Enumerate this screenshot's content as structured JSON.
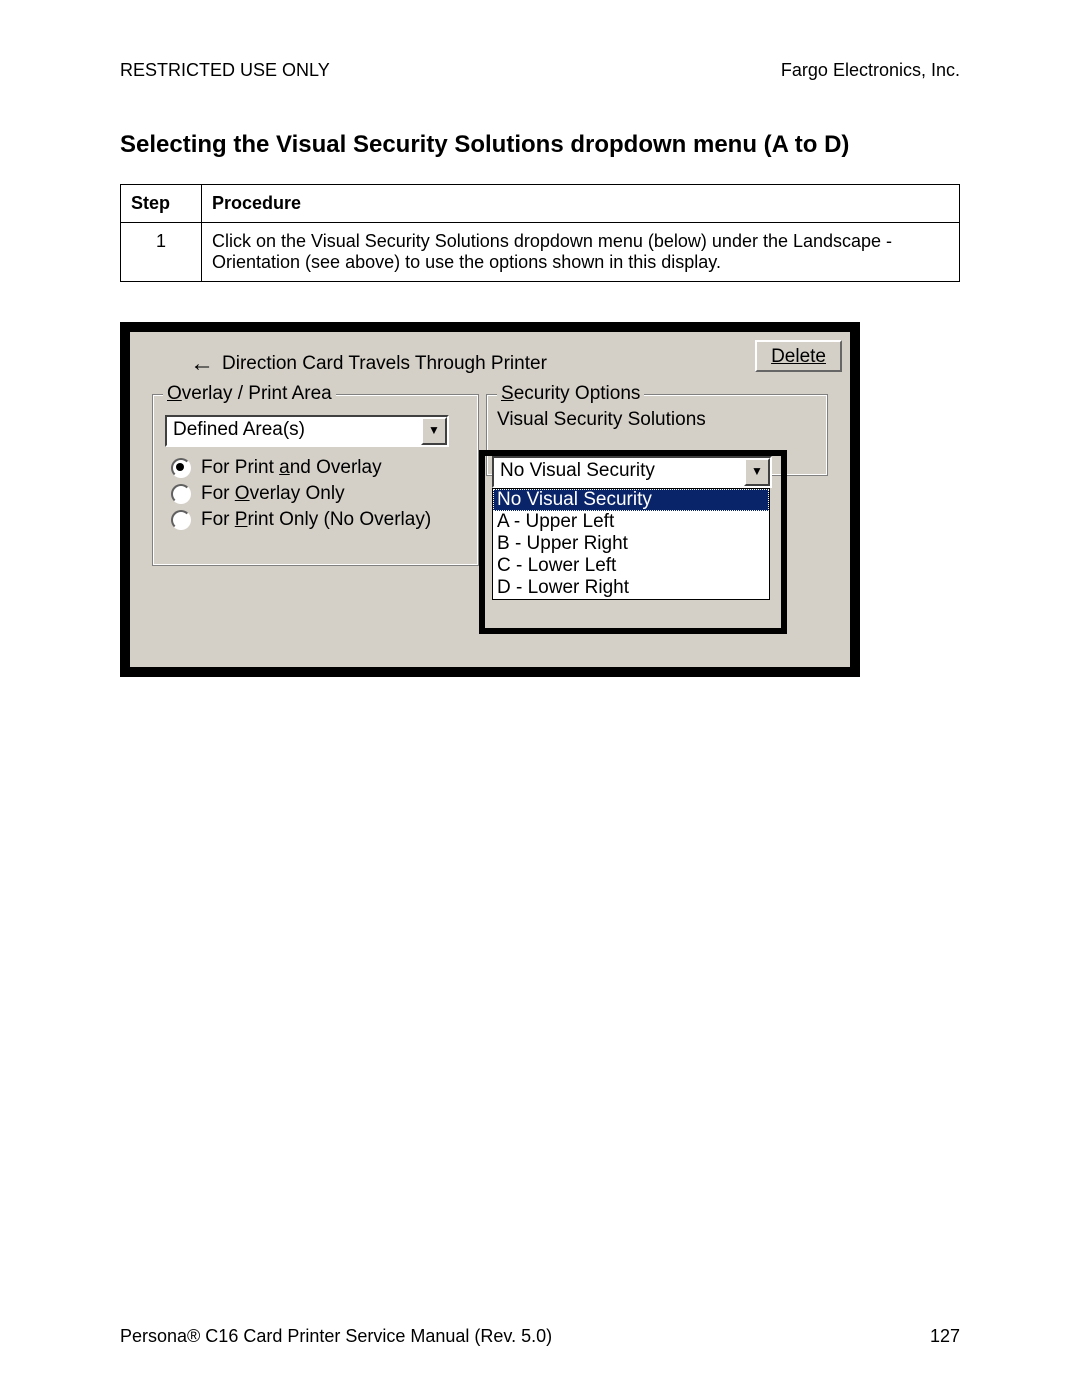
{
  "header": {
    "left": "RESTRICTED USE ONLY",
    "right": "Fargo Electronics, Inc."
  },
  "section_title": "Selecting the Visual Security Solutions dropdown menu (A to D)",
  "table": {
    "col1": "Step",
    "col2": "Procedure",
    "row1_step": "1",
    "row1_proc": "Click on the Visual Security Solutions dropdown menu (below) under the Landscape - Orientation (see above) to use the options shown in this display."
  },
  "ui": {
    "direction_label": "Direction Card Travels Through Printer",
    "delete_btn": "Delete",
    "overlay_group": "verlay / Print Area",
    "overlay_group_ul": "O",
    "overlay_combo": "Defined Area(s)",
    "radio1_pre": "For Print ",
    "radio1_ul": "a",
    "radio1_post": "nd Overlay",
    "radio2_pre": "For ",
    "radio2_ul": "O",
    "radio2_post": "verlay Only",
    "radio3_pre": "For ",
    "radio3_ul": "P",
    "radio3_post": "rint Only (No Overlay)",
    "security_group_ul": "S",
    "security_group": "ecurity Options",
    "security_label": "Visual Security Solutions",
    "security_combo": "No Visual Security",
    "options": {
      "o0": "No Visual Security",
      "o1": "A - Upper Left",
      "o2": "B - Upper Right",
      "o3": "C - Lower Left",
      "o4": "D - Lower Right"
    }
  },
  "footer": {
    "left": "Persona® C16 Card Printer Service Manual (Rev. 5.0)",
    "right": "127"
  }
}
